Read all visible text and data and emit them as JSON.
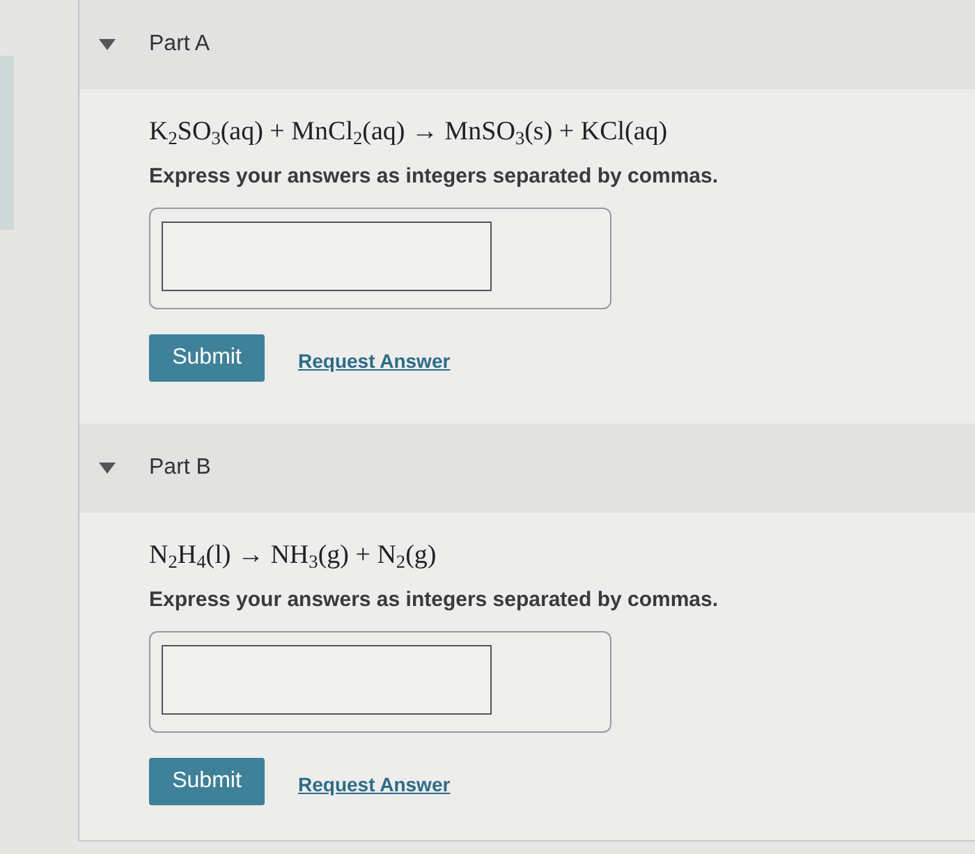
{
  "parts": [
    {
      "title": "Part A",
      "expanded": true,
      "equation": "K$_{2}$SO$_{3}$(aq) + MnCl$_{2}$(aq) → MnSO$_{3}$(s) + KCl(aq)",
      "instruction": "Express your answers as integers separated by commas.",
      "submit": "Submit",
      "request": "Request Answer"
    },
    {
      "title": "Part B",
      "expanded": true,
      "equation": "N$_{2}$H$_{4}$(l) → NH$_{3}$(g) + N$_{2}$(g)",
      "instruction": "Express your answers as integers separated by commas.",
      "submit": "Submit",
      "request": "Request Answer"
    }
  ]
}
